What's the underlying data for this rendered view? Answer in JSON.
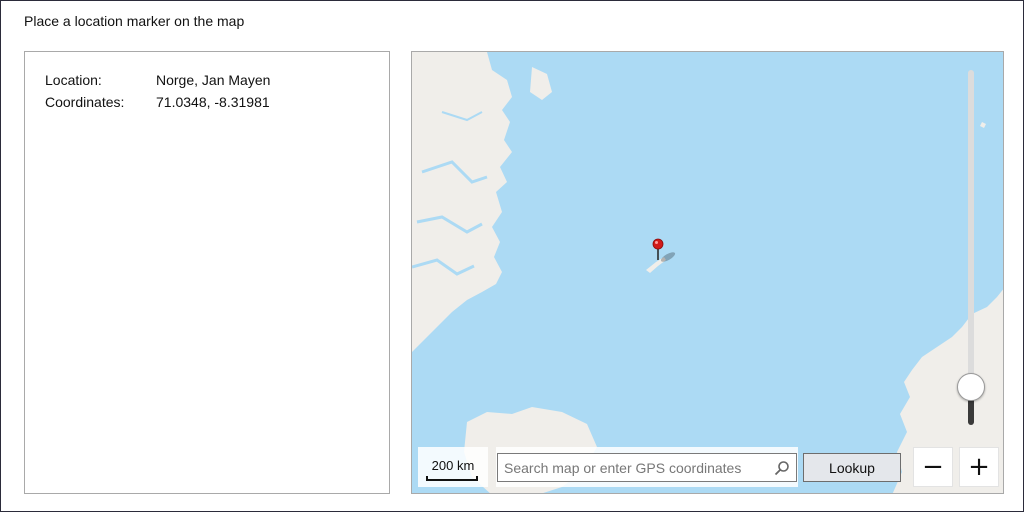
{
  "prompt": "Place a location marker on the map",
  "info": {
    "location_label": "Location:",
    "location_value": "Norge, Jan Mayen",
    "coordinates_label": "Coordinates:",
    "coordinates_value": "71.0348, -8.31981"
  },
  "map": {
    "scale_label": "200 km",
    "search_placeholder": "Search map or enter GPS coordinates",
    "search_value": "",
    "lookup_label": "Lookup",
    "zoom_out_label": "−",
    "zoom_in_label": "+",
    "zoom_level_fraction": 0.1,
    "colors": {
      "water": "#acdaf4",
      "land": "#f0eeea",
      "pin": "#d11a1a"
    },
    "icons": {
      "search": "search-icon",
      "marker": "location-marker-icon"
    }
  }
}
